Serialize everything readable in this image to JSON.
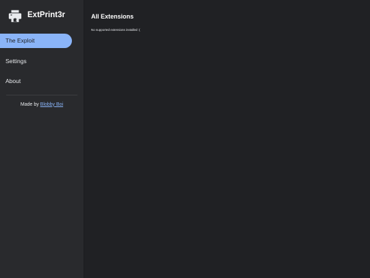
{
  "app": {
    "title": "ExtPrint3r",
    "icon": "printer-puzzle-icon"
  },
  "sidebar": {
    "items": [
      {
        "label": "The Exploit",
        "active": true
      },
      {
        "label": "Settings",
        "active": false
      },
      {
        "label": "About",
        "active": false
      }
    ],
    "credit_prefix": "Made by ",
    "credit_link": "Blobby Boi"
  },
  "main": {
    "title": "All Extensions",
    "message": "No supported extensions installed :("
  },
  "colors": {
    "accent": "#8ab4f8",
    "sidebar_bg": "#292a2d",
    "main_bg": "#202124",
    "text": "#e8eaed"
  }
}
